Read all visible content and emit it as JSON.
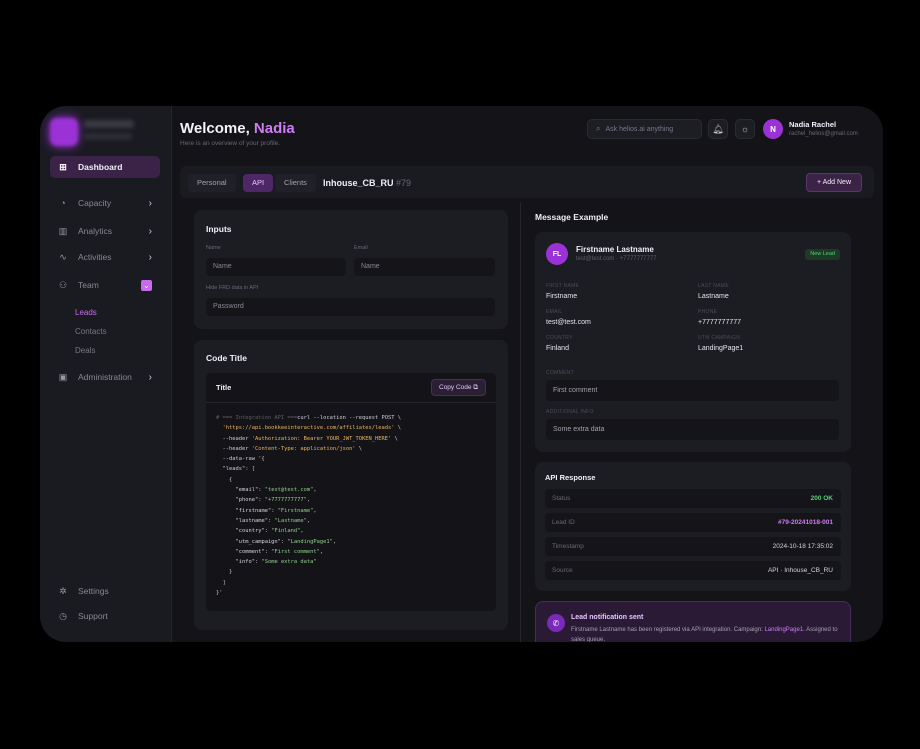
{
  "sidebar": {
    "items": [
      {
        "label": "Dashboard",
        "icon": "grid-icon"
      },
      {
        "label": "Capacity",
        "icon": "pie-icon"
      },
      {
        "label": "Analytics",
        "icon": "bar-chart-icon"
      },
      {
        "label": "Activities",
        "icon": "pulse-icon"
      },
      {
        "label": "Team",
        "icon": "users-icon"
      },
      {
        "label": "Administration",
        "icon": "admin-icon"
      }
    ],
    "team_sub": [
      "Leads",
      "Contacts",
      "Deals"
    ],
    "settings_label": "Settings",
    "support_label": "Support"
  },
  "header": {
    "welcome_prefix": "Welcome,",
    "welcome_name": "Nadia",
    "subtitle": "Here is an overview of your profile.",
    "search_placeholder": "Ask helios.ai anything",
    "user_name": "Nadia Rachel",
    "user_email": "rachel_helios@gmail.com",
    "avatar_initial": "N"
  },
  "tabs": {
    "items": [
      "Personal",
      "API",
      "Clients"
    ],
    "active": "API",
    "title": "Inhouse_CB_RU",
    "title_num": "#79",
    "add_label": "Add New"
  },
  "inputs": {
    "title": "Inputs",
    "name_label": "Name",
    "name_placeholder": "Name",
    "email_label": "Email",
    "email_placeholder": "Name",
    "hide_label": "Hide FRD data in API",
    "password_placeholder": "Password"
  },
  "code": {
    "panel_title": "Code Title",
    "box_title": "Title",
    "copy_label": "Copy Code",
    "lines": [
      "# === Integration API ===curl --location --request POST \\",
      "  'https://api.bookkeeinteractive.com/affiliates/leads' \\",
      "  --header 'Authorization: Bearer YOUR_JWT_TOKEN_HERE' \\",
      "  --header 'Content-Type: application/json' \\",
      "  --data-raw '{",
      "  \"leads\": [",
      "    {",
      "      \"email\": \"test@test.com\",",
      "      \"phone\": \"+7777777777\",",
      "      \"firstname\": \"Firstname\",",
      "      \"lastname\": \"Lastname\",",
      "      \"country\": \"Finland\",",
      "      \"utm_campaign\": \"LandingPage1\",",
      "      \"comment\": \"First comment\",",
      "      \"info\": \"Some extra data\"",
      "    }",
      "  ]",
      "}'"
    ]
  },
  "message": {
    "section_title": "Message Example",
    "initials": "FL",
    "name": "Firstname Lastname",
    "sub": "test@test.com · +7777777777",
    "badge": "New Lead",
    "fields": [
      {
        "label": "FIRST NAME",
        "value": "Firstname"
      },
      {
        "label": "LAST NAME",
        "value": "Lastname"
      },
      {
        "label": "EMAIL",
        "value": "test@test.com"
      },
      {
        "label": "PHONE",
        "value": "+7777777777"
      },
      {
        "label": "COUNTRY",
        "value": "Finland"
      },
      {
        "label": "UTM CAMPAIGN",
        "value": "LandingPage1"
      }
    ],
    "comment_label": "COMMENT",
    "comment_value": "First comment",
    "info_label": "ADDITIONAL INFO",
    "info_value": "Some extra data"
  },
  "api": {
    "title": "API Response",
    "rows": [
      {
        "key": "Status",
        "value": "200 OK",
        "color": "#5bd07a"
      },
      {
        "key": "Lead ID",
        "value": "#79-20241018-001",
        "color": "#d07cf5"
      },
      {
        "key": "Timestamp",
        "value": "2024-10-18 17:35:02",
        "color": "#d6d4e0"
      },
      {
        "key": "Source",
        "value": "API · Inhouse_CB_RU",
        "color": "#d6d4e0"
      }
    ]
  },
  "notification": {
    "title": "Lead notification sent",
    "body_prefix": "Firstname Lastname has been registered via API integration. Campaign:",
    "body_campaign": "LandingPage1.",
    "body_suffix": "Assigned to sales queue."
  },
  "colors": {
    "accent": "#9b32d6",
    "accent_light": "#d07cf5",
    "success": "#5bd07a",
    "background": "#131318"
  }
}
